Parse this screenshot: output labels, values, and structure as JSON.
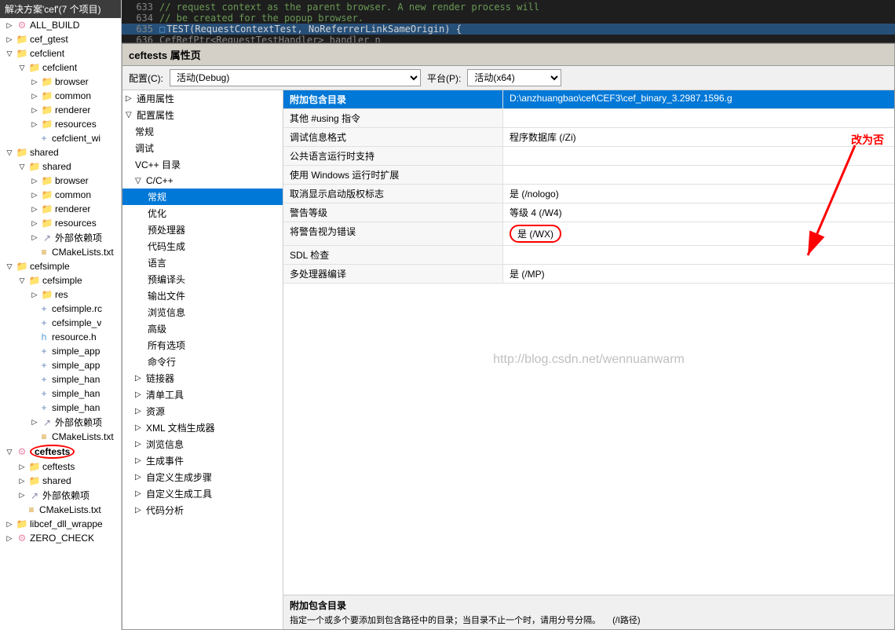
{
  "solution_explorer": {
    "header": "解决方案'cef'(7 个项目)",
    "items": [
      {
        "id": "all_build",
        "label": "ALL_BUILD",
        "level": 0,
        "type": "build",
        "expanded": false
      },
      {
        "id": "cef_gtest",
        "label": "cef_gtest",
        "level": 0,
        "type": "project",
        "expanded": false
      },
      {
        "id": "cefclient",
        "label": "cefclient",
        "level": 0,
        "type": "project",
        "expanded": true
      },
      {
        "id": "cefclient2",
        "label": "cefclient",
        "level": 1,
        "type": "folder",
        "expanded": true
      },
      {
        "id": "browser",
        "label": "browser",
        "level": 2,
        "type": "folder",
        "expanded": false
      },
      {
        "id": "common",
        "label": "common",
        "level": 2,
        "type": "folder",
        "expanded": false
      },
      {
        "id": "renderer",
        "label": "renderer",
        "level": 2,
        "type": "folder",
        "expanded": false
      },
      {
        "id": "resources",
        "label": "resources",
        "level": 2,
        "type": "folder",
        "expanded": false
      },
      {
        "id": "cefclient_wi",
        "label": "cefclient_wi",
        "level": 2,
        "type": "file",
        "expanded": false
      },
      {
        "id": "shared_root",
        "label": "shared",
        "level": 0,
        "type": "project",
        "expanded": true
      },
      {
        "id": "shared_folder",
        "label": "shared",
        "level": 1,
        "type": "folder",
        "expanded": true
      },
      {
        "id": "shared_browser",
        "label": "browser",
        "level": 2,
        "type": "folder",
        "expanded": false
      },
      {
        "id": "shared_common",
        "label": "common",
        "level": 2,
        "type": "folder",
        "expanded": false
      },
      {
        "id": "shared_renderer",
        "label": "renderer",
        "level": 2,
        "type": "folder",
        "expanded": false
      },
      {
        "id": "shared_resources",
        "label": "resources",
        "level": 2,
        "type": "folder",
        "expanded": false
      },
      {
        "id": "wai_deps",
        "label": "外部依赖项",
        "level": 2,
        "type": "ref",
        "expanded": false
      },
      {
        "id": "cmake_shared",
        "label": "CMakeLists.txt",
        "level": 2,
        "type": "cmake",
        "expanded": false
      },
      {
        "id": "cefsimple_root",
        "label": "cefsimple",
        "level": 0,
        "type": "project",
        "expanded": true
      },
      {
        "id": "cefsimple_folder",
        "label": "cefsimple",
        "level": 1,
        "type": "folder",
        "expanded": true
      },
      {
        "id": "res",
        "label": "res",
        "level": 2,
        "type": "folder",
        "expanded": false
      },
      {
        "id": "cefsimple_rc",
        "label": "cefsimple.rc",
        "level": 2,
        "type": "file",
        "expanded": false
      },
      {
        "id": "cefsimple_v",
        "label": "cefsimple_v",
        "level": 2,
        "type": "file",
        "expanded": false
      },
      {
        "id": "resource_h",
        "label": "resource.h",
        "level": 2,
        "type": "header",
        "expanded": false
      },
      {
        "id": "simple_app",
        "label": "simple_app",
        "level": 2,
        "type": "cpp",
        "expanded": false
      },
      {
        "id": "simple_app2",
        "label": "simple_app",
        "level": 2,
        "type": "cpp",
        "expanded": false
      },
      {
        "id": "simple_han",
        "label": "simple_han",
        "level": 2,
        "type": "cpp",
        "expanded": false
      },
      {
        "id": "simple_han2",
        "label": "simple_han",
        "level": 2,
        "type": "cpp",
        "expanded": false
      },
      {
        "id": "simple_han3",
        "label": "simple_han",
        "level": 2,
        "type": "cpp",
        "expanded": false
      },
      {
        "id": "cefsimple_deps",
        "label": "外部依赖项",
        "level": 2,
        "type": "ref",
        "expanded": false
      },
      {
        "id": "cmake_cefsimple",
        "label": "CMakeLists.txt",
        "level": 2,
        "type": "cmake",
        "expanded": false
      },
      {
        "id": "ceftests_root",
        "label": "ceftests",
        "level": 0,
        "type": "project",
        "expanded": true,
        "highlighted": true
      },
      {
        "id": "ceftests_folder",
        "label": "ceftests",
        "level": 1,
        "type": "folder",
        "expanded": false
      },
      {
        "id": "shared_inner",
        "label": "shared",
        "level": 1,
        "type": "folder",
        "expanded": false
      },
      {
        "id": "ceftests_deps",
        "label": "外部依赖项",
        "level": 1,
        "type": "ref",
        "expanded": false
      },
      {
        "id": "cmake_ceftests",
        "label": "CMakeLists.txt",
        "level": 1,
        "type": "cmake",
        "expanded": false
      },
      {
        "id": "libcef_wrapper",
        "label": "libcef_dll_wrappe",
        "level": 0,
        "type": "project",
        "expanded": false
      },
      {
        "id": "zero_check",
        "label": "ZERO_CHECK",
        "level": 0,
        "type": "build",
        "expanded": false
      }
    ]
  },
  "code_editor": {
    "lines": [
      {
        "num": "633",
        "content": "// request context as the parent browser. A new render process will",
        "type": "comment"
      },
      {
        "num": "634",
        "content": "// be created for the popup browser.",
        "type": "comment"
      },
      {
        "num": "635",
        "content": "TEST(RequestContextTest, NoReferrerLinkSameOrigin) {",
        "type": "highlight"
      },
      {
        "num": "636",
        "content": "  CefRefPtr<RequestTestHandler> handler n",
        "type": "normal"
      }
    ]
  },
  "dialog": {
    "title": "ceftests 属性页",
    "config_label": "配置(C):",
    "config_value": "活动(Debug)",
    "platform_label": "平台(P):",
    "platform_value": "活动(x64)",
    "tree": [
      {
        "id": "general",
        "label": "通用属性",
        "level": 0,
        "expanded": false
      },
      {
        "id": "config_props",
        "label": "配置属性",
        "level": 0,
        "expanded": true
      },
      {
        "id": "general2",
        "label": "常规",
        "level": 1
      },
      {
        "id": "debug",
        "label": "调试",
        "level": 1
      },
      {
        "id": "vcpp_dirs",
        "label": "VC++ 目录",
        "level": 1
      },
      {
        "id": "cpp_section",
        "label": "C/C++",
        "level": 1,
        "expanded": true
      },
      {
        "id": "cpp_general",
        "label": "常规",
        "level": 2,
        "active": true
      },
      {
        "id": "optimize",
        "label": "优化",
        "level": 2
      },
      {
        "id": "preprocessor",
        "label": "预处理器",
        "level": 2
      },
      {
        "id": "code_gen",
        "label": "代码生成",
        "level": 2
      },
      {
        "id": "language",
        "label": "语言",
        "level": 2
      },
      {
        "id": "precompiled",
        "label": "预编译头",
        "level": 2
      },
      {
        "id": "output_files",
        "label": "输出文件",
        "level": 2
      },
      {
        "id": "browse_info",
        "label": "浏览信息",
        "level": 2
      },
      {
        "id": "advanced",
        "label": "高级",
        "level": 2
      },
      {
        "id": "all_options",
        "label": "所有选项",
        "level": 2
      },
      {
        "id": "cmdline",
        "label": "命令行",
        "level": 2
      },
      {
        "id": "linker",
        "label": "链接器",
        "level": 1,
        "expanded": false
      },
      {
        "id": "manifest_tool",
        "label": "清单工具",
        "level": 1
      },
      {
        "id": "resources2",
        "label": "资源",
        "level": 1
      },
      {
        "id": "xml_gen",
        "label": "XML 文档生成器",
        "level": 1
      },
      {
        "id": "browse2",
        "label": "浏览信息",
        "level": 1
      },
      {
        "id": "build_events",
        "label": "生成事件",
        "level": 1
      },
      {
        "id": "custom_build",
        "label": "自定义生成步骤",
        "level": 1
      },
      {
        "id": "custom_tools",
        "label": "自定义生成工具",
        "level": 1
      },
      {
        "id": "code_analysis",
        "label": "代码分析",
        "level": 1
      }
    ],
    "properties": [
      {
        "name": "附加包含目录",
        "value": "D:\\anzhuangbao\\cef\\CEF3\\cef_binary_3.2987.1596.g",
        "is_header": true
      },
      {
        "name": "其他 #using 指令",
        "value": ""
      },
      {
        "name": "调试信息格式",
        "value": "程序数据库 (/Zi)"
      },
      {
        "name": "公共语言运行时支持",
        "value": ""
      },
      {
        "name": "使用 Windows 运行时扩展",
        "value": ""
      },
      {
        "name": "取消显示启动版权标志",
        "value": "是 (/nologo)"
      },
      {
        "name": "警告等级",
        "value": "等级 4 (/W4)"
      },
      {
        "name": "将警告视为错误",
        "value": "是 (/WX)",
        "circled": true
      },
      {
        "name": "SDL 检查",
        "value": ""
      },
      {
        "name": "多处理器编译",
        "value": "是 (/MP)"
      }
    ],
    "watermark": "http://blog.csdn.net/wennuanwarm",
    "annotation_text": "改为否",
    "footer_title": "附加包含目录",
    "footer_desc": "指定一个或多个要添加到包含路径中的目录；当目录不止一个时，请用分号分隔。",
    "footer_suffix": "(/I路径)"
  }
}
